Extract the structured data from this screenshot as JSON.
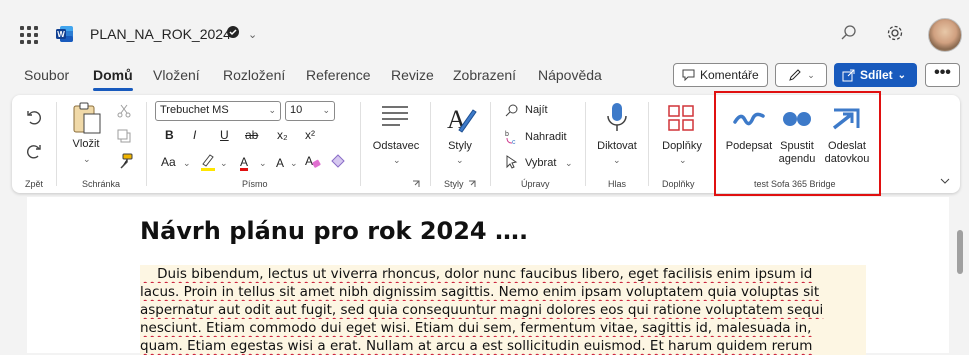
{
  "titlebar": {
    "doc_title": "PLAN_NA_ROK_2024",
    "icons": [
      "app-launcher-icon",
      "word-icon",
      "saved-status-icon",
      "chevron-down-icon",
      "search-icon",
      "settings-icon",
      "avatar"
    ]
  },
  "tabs": [
    "Soubor",
    "Domů",
    "Vložení",
    "Rozložení",
    "Reference",
    "Revize",
    "Zobrazení",
    "Nápověda"
  ],
  "active_tab": "Domů",
  "actions": {
    "comments": "Komentáře",
    "share": "Sdílet",
    "more": "•••"
  },
  "ribbon": {
    "undo_group_label": "Zpět",
    "clipboard": {
      "paste": "Vložit",
      "group_label": "Schránka"
    },
    "font": {
      "name": "Trebuchet MS",
      "size": "10",
      "group_label": "Písmo",
      "bold": "B",
      "italic": "I",
      "underline": "U",
      "strike": "ab",
      "subscript": "x₂",
      "superscript": "x²",
      "case": "Aa",
      "color_a": "A"
    },
    "paragraph": {
      "label": "Odstavec"
    },
    "styles": {
      "label": "Styly",
      "group_label": "Styly"
    },
    "editing": {
      "find": "Najít",
      "replace": "Nahradit",
      "select": "Vybrat",
      "group_label": "Úpravy"
    },
    "voice": {
      "dictate": "Diktovat",
      "group_label": "Hlas"
    },
    "addins": {
      "label": "Doplňky",
      "group_label": "Doplňky"
    },
    "sofa": {
      "sign": "Podepsat",
      "run_1": "Spustit",
      "run_2": "agendu",
      "send_1": "Odeslat",
      "send_2": "datovkou",
      "group_label": "test Sofa 365 Bridge"
    },
    "accent": "#185abd",
    "highlight_border": "#e01010"
  },
  "document": {
    "heading": "Návrh plánu pro rok 2024 ….",
    "lines": [
      "    Duis bibendum, lectus ut viverra rhoncus, dolor nunc faucibus libero, eget facilisis enim ipsum id",
      "lacus. Proin in tellus sit amet nibh dignissim sagittis. Nemo enim ipsam voluptatem quia voluptas sit",
      "aspernatur aut odit aut fugit, sed quia consequuntur magni dolores eos qui ratione voluptatem sequi",
      "nesciunt. Etiam commodo dui eget wisi. Etiam dui sem, fermentum vitae, sagittis id, malesuada in,",
      "quam. Etiam egestas wisi a erat. Nullam at arcu a est sollicitudin euismod. Et harum quidem rerum"
    ]
  }
}
